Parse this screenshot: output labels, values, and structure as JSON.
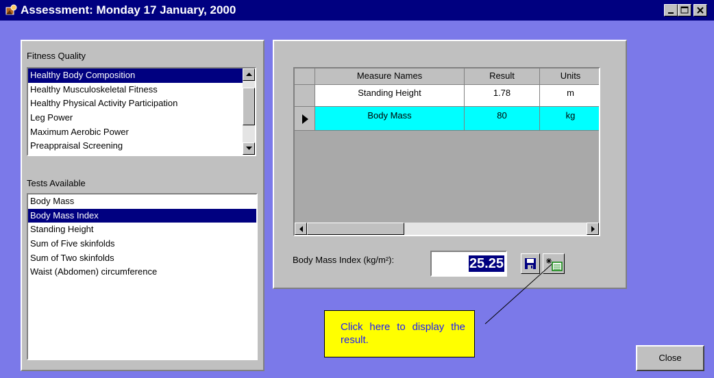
{
  "window": {
    "title": "Assessment: Monday 17 January, 2000",
    "controls": [
      "minimize-icon",
      "maximize-icon",
      "close-icon"
    ]
  },
  "fitness_quality": {
    "label": "Fitness Quality",
    "items": [
      "Healthy Body Composition",
      "Healthy Musculoskeletal Fitness",
      "Healthy Physical Activity Participation",
      "Leg Power",
      "Maximum Aerobic Power",
      "Preappraisal Screening"
    ],
    "selected": "Healthy Body Composition"
  },
  "tests_available": {
    "label": "Tests Available",
    "items": [
      "Body Mass",
      "Body Mass Index",
      "Standing  Height",
      "Sum of Five skinfolds",
      "Sum of Two skinfolds",
      "Waist (Abdomen) circumference"
    ],
    "selected": "Body Mass Index"
  },
  "measures_grid": {
    "columns": [
      "Measure Names",
      "Result",
      "Units"
    ],
    "rows": [
      {
        "name": "Standing  Height",
        "result": "1.78",
        "units": "m"
      },
      {
        "name": "Body Mass",
        "result": "80",
        "units": "kg"
      }
    ],
    "current_row": "Body Mass"
  },
  "bmi": {
    "label": "Body Mass Index (kg/m²):",
    "value": "25.25"
  },
  "buttons": {
    "save_icon": "save-disk-icon",
    "calculate_icon": "magic-wand-icon",
    "close_label": "Close"
  },
  "callout": {
    "text": "Click here to display the result."
  },
  "colors": {
    "title_bar": "#000080",
    "client_background": "#7b79e9",
    "selection": "#000080",
    "current_row": "#00ffff",
    "callout_background": "#ffff00",
    "callout_text": "#1a1aff"
  }
}
